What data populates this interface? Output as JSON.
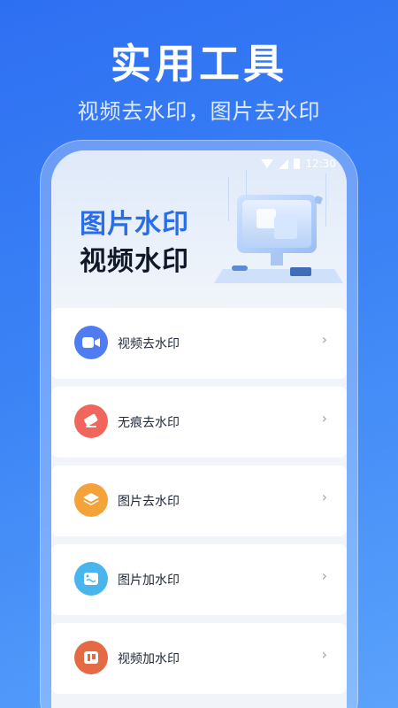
{
  "header": {
    "title": "实用工具",
    "subtitle": "视频去水印，图片去水印"
  },
  "status_bar": {
    "time": "12:30"
  },
  "banner": {
    "line1": "图片水印",
    "line2": "视频水印"
  },
  "tools": [
    {
      "label": "视频去水印",
      "icon": "video-camera-icon",
      "color": "#4f7cf0"
    },
    {
      "label": "无痕去水印",
      "icon": "eraser-icon",
      "color": "#f0665c"
    },
    {
      "label": "图片去水印",
      "icon": "layers-icon",
      "color": "#f4a23a"
    },
    {
      "label": "图片加水印",
      "icon": "image-icon",
      "color": "#49b5ee"
    },
    {
      "label": "视频加水印",
      "icon": "stamp-icon",
      "color": "#e46a45"
    }
  ],
  "chevron": "›"
}
